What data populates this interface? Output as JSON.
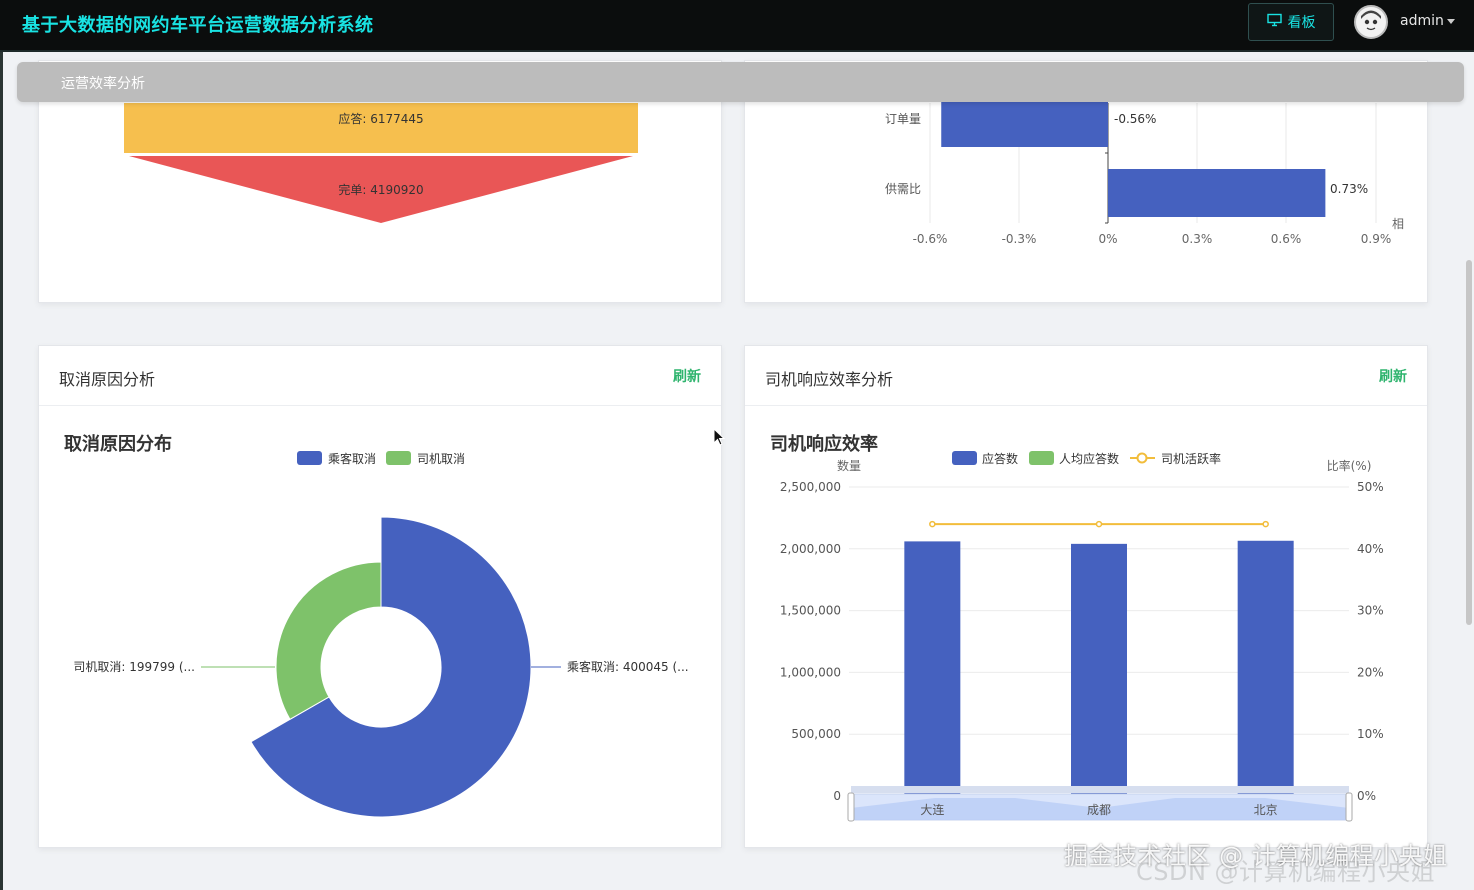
{
  "app": {
    "title": "基于大数据的网约车平台运营数据分析系统"
  },
  "header": {
    "board_label": "看板",
    "user": "admin"
  },
  "breadcrumb": {
    "label": "运营效率分析"
  },
  "funnel": {
    "items": [
      {
        "label": "应答: 6177445",
        "color": "#f6bf4e"
      },
      {
        "label": "完单: 4190920",
        "color": "#e95656"
      }
    ]
  },
  "growth_bar": {
    "categories": [
      "订单量",
      "供需比"
    ],
    "values": [
      -0.56,
      0.73
    ],
    "value_labels": [
      "-0.56%",
      "0.73%"
    ],
    "xticks": [
      "-0.6%",
      "-0.3%",
      "0%",
      "0.3%",
      "0.6%",
      "0.9%"
    ],
    "axis_name": "相",
    "color": "#4561bf"
  },
  "cancel_card": {
    "header": "取消原因分析",
    "refresh": "刷新",
    "chart_title": "取消原因分布",
    "legend": [
      {
        "name": "乘客取消",
        "color": "#4561bf"
      },
      {
        "name": "司机取消",
        "color": "#7ec26a"
      }
    ],
    "slices": [
      {
        "label": "乘客取消: 400045 (...",
        "value": 400045,
        "color": "#4561bf"
      },
      {
        "label": "司机取消: 199799 (...",
        "value": 199799,
        "color": "#7ec26a"
      }
    ]
  },
  "driver_card": {
    "header": "司机响应效率分析",
    "refresh": "刷新",
    "chart_title": "司机响应效率",
    "legend": [
      {
        "name": "应答数",
        "color": "#4561bf"
      },
      {
        "name": "人均应答数",
        "color": "#7ec26a"
      },
      {
        "name": "司机活跃率",
        "color": "#f2bd3b"
      }
    ],
    "left_axis_name": "数量",
    "right_axis_name": "比率(%)",
    "left_ticks": [
      "0",
      "500,000",
      "1,000,000",
      "1,500,000",
      "2,000,000",
      "2,500,000"
    ],
    "right_ticks": [
      "0%",
      "10%",
      "20%",
      "30%",
      "40%",
      "50%"
    ]
  },
  "chart_data": [
    {
      "type": "bar",
      "orientation": "horizontal",
      "categories": [
        "订单量",
        "供需比"
      ],
      "values": [
        -0.56,
        0.73
      ],
      "xlim": [
        -0.6,
        0.9
      ],
      "unit": "%"
    },
    {
      "type": "pie",
      "title": "取消原因分布",
      "labels": [
        "乘客取消",
        "司机取消"
      ],
      "values": [
        400045,
        199799
      ]
    },
    {
      "type": "bar",
      "title": "司机响应效率",
      "categories": [
        "大连",
        "成都",
        "北京"
      ],
      "series": [
        {
          "name": "应答数",
          "type": "bar",
          "values": [
            2060000,
            2040000,
            2065000
          ]
        },
        {
          "name": "人均应答数",
          "type": "bar",
          "values": [
            null,
            null,
            null
          ]
        },
        {
          "name": "司机活跃率",
          "type": "line",
          "axis": "right",
          "values": [
            44,
            44,
            44
          ]
        }
      ],
      "ylim": [
        0,
        2500000
      ],
      "y2lim": [
        0,
        50
      ],
      "ylabel": "数量",
      "y2label": "比率(%)"
    }
  ],
  "watermark": {
    "text": "掘金技术社区 @ 计算机编程小央姐",
    "text2": "CSDN @计算机编程小央姐"
  }
}
